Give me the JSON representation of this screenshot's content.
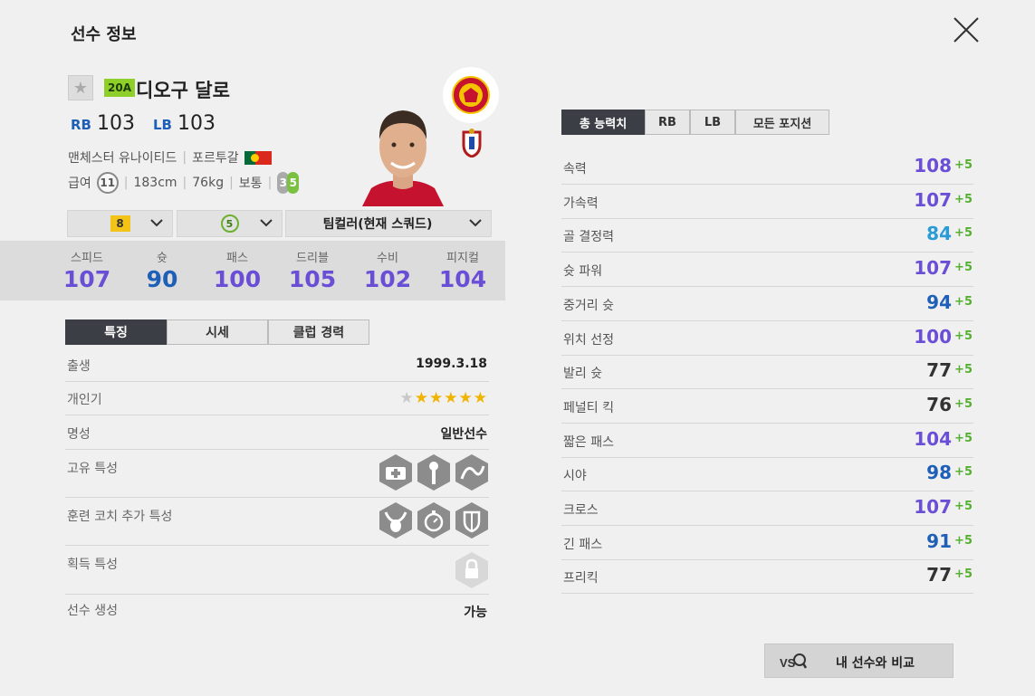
{
  "header": {
    "page_title": "선수 정보",
    "season_badge": "20A",
    "player_name": "디오구 달로",
    "positions": [
      {
        "pos": "RB",
        "ovr": "103"
      },
      {
        "pos": "LB",
        "ovr": "103"
      }
    ],
    "club": "맨체스터 유나이티드",
    "nation": "포르투갈",
    "salary_label": "급여",
    "salary": "11",
    "height": "183cm",
    "weight": "76kg",
    "body_type": "보통",
    "weak_foot": "3",
    "strong_foot": "5"
  },
  "selectors": {
    "enhancement": "8",
    "level": "5",
    "team_color": "팀컬러(현재 스쿼드)"
  },
  "key_stats": [
    {
      "label": "스피드",
      "value": "107",
      "color": "#6a4fd6"
    },
    {
      "label": "슛",
      "value": "90",
      "color": "#1e5fb8"
    },
    {
      "label": "패스",
      "value": "100",
      "color": "#6a4fd6"
    },
    {
      "label": "드리블",
      "value": "105",
      "color": "#6a4fd6"
    },
    {
      "label": "수비",
      "value": "102",
      "color": "#6a4fd6"
    },
    {
      "label": "피지컬",
      "value": "104",
      "color": "#6a4fd6"
    }
  ],
  "tabs": [
    "특징",
    "시세",
    "클럽 경력"
  ],
  "traits": {
    "birth_label": "출생",
    "birth_value": "1999.3.18",
    "popularity_label": "개인기",
    "popularity_stars": 5,
    "popularity_max": 6,
    "fame_label": "명성",
    "fame_value": "일반선수",
    "unique_label": "고유 특성",
    "coach_label": "훈련 코치 추가 특성",
    "acquired_label": "획득 특성",
    "creation_label": "선수 생성",
    "creation_value": "가능",
    "icons": {
      "unique": [
        "medic-icon",
        "injury-prone-icon",
        "long-throw-icon"
      ],
      "coach": [
        "bull-icon",
        "stopwatch-icon",
        "shield-icon"
      ],
      "acquired": [
        "lock-icon"
      ]
    }
  },
  "position_tabs": [
    "총 능력치",
    "RB",
    "LB",
    "모든 포지션"
  ],
  "attributes": [
    {
      "name": "속력",
      "value": "108",
      "bonus": "+5",
      "color": "#6a4fd6"
    },
    {
      "name": "가속력",
      "value": "107",
      "bonus": "+5",
      "color": "#6a4fd6"
    },
    {
      "name": "골 결정력",
      "value": "84",
      "bonus": "+5",
      "color": "#2b9bd6"
    },
    {
      "name": "슛 파워",
      "value": "107",
      "bonus": "+5",
      "color": "#6a4fd6"
    },
    {
      "name": "중거리 슛",
      "value": "94",
      "bonus": "+5",
      "color": "#1e5fb8"
    },
    {
      "name": "위치 선정",
      "value": "100",
      "bonus": "+5",
      "color": "#6a4fd6"
    },
    {
      "name": "발리 슛",
      "value": "77",
      "bonus": "+5",
      "color": "#333333"
    },
    {
      "name": "페널티 킥",
      "value": "76",
      "bonus": "+5",
      "color": "#333333"
    },
    {
      "name": "짧은 패스",
      "value": "104",
      "bonus": "+5",
      "color": "#6a4fd6"
    },
    {
      "name": "시야",
      "value": "98",
      "bonus": "+5",
      "color": "#1e5fb8"
    },
    {
      "name": "크로스",
      "value": "107",
      "bonus": "+5",
      "color": "#6a4fd6"
    },
    {
      "name": "긴 패스",
      "value": "91",
      "bonus": "+5",
      "color": "#1e5fb8"
    },
    {
      "name": "프리킥",
      "value": "77",
      "bonus": "+5",
      "color": "#333333"
    }
  ],
  "compare_button": "내 선수와 비교",
  "colors": {
    "accent_dark": "#3b3f45",
    "bonus_green": "#56b02f",
    "badge_green": "#8fcf2a",
    "enhance_gold": "#f3c318"
  }
}
